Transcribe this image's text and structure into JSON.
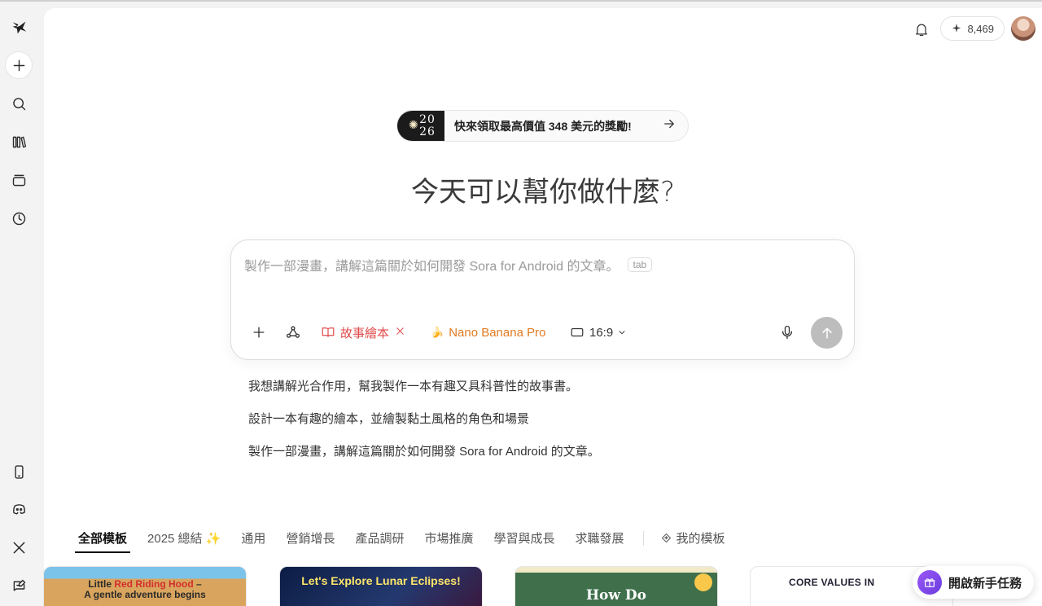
{
  "topbar": {
    "credits": "8,469"
  },
  "promo": {
    "year_top": "20",
    "year_bottom": "26",
    "text": "快來領取最高價值 348 美元的獎勵!"
  },
  "headline": "今天可以幫你做什麼?",
  "composer": {
    "placeholder": "製作一部漫畫，講解這篇關於如何開發 Sora for Android 的文章。",
    "tab_hint": "tab",
    "story_chip": "故事繪本",
    "model_emoji": "🍌",
    "model_chip": "Nano Banana Pro",
    "ratio": "16:9"
  },
  "suggestions": [
    "我想講解光合作用，幫我製作一本有趣又具科普性的故事書。",
    "設計一本有趣的繪本，並繪製黏土風格的角色和場景",
    "製作一部漫畫，講解這篇關於如何開發 Sora for Android 的文章。"
  ],
  "categories": {
    "all": "全部模板",
    "recap": "2025 總結",
    "recap_emoji": "✨",
    "general": "通用",
    "marketing": "營銷增長",
    "product": "產品調研",
    "market": "市場推廣",
    "learning": "學習與成長",
    "career": "求職發展",
    "mine": "我的模板"
  },
  "cards": {
    "card1_title_a": "Little ",
    "card1_title_red": "Red Riding Hood",
    "card1_title_b": " –",
    "card1_subtitle": "A gentle adventure begins",
    "card2_title": "Let's Explore Lunar Eclipses!",
    "card3_title": "How Do",
    "card4_title": "CORE VALUES IN"
  },
  "task_button": "開啟新手任務",
  "colors": {
    "accent_red": "#e04a4a",
    "accent_orange": "#e07b22",
    "send_disabled": "#bdbdbd",
    "task_purple": "#7b45ea"
  }
}
